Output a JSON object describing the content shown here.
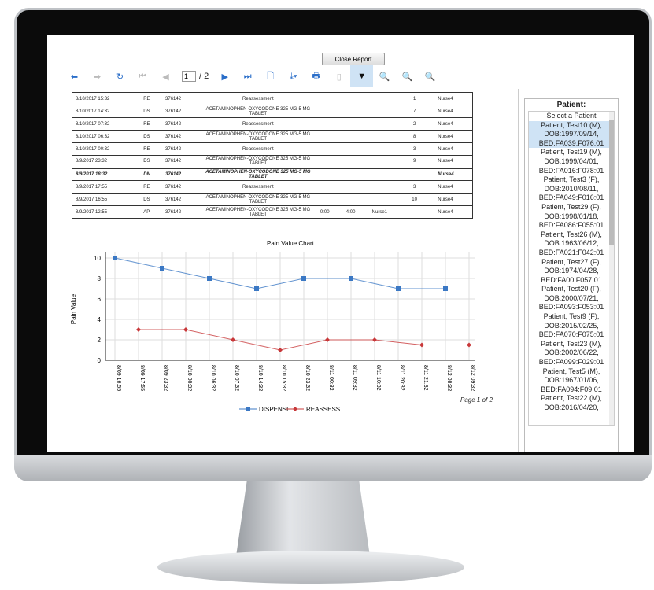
{
  "toolbar": {
    "close_label": "Close Report",
    "page_current": "1",
    "page_total": "/ 2",
    "icons": [
      "back-icon",
      "forward-icon",
      "refresh-icon",
      "first-page-icon",
      "prev-page-icon",
      "next-page-icon",
      "last-page-icon",
      "page-icon",
      "export-icon",
      "print-icon",
      "print-layout-icon",
      "filter-icon",
      "zoom-in-icon",
      "zoom-out-icon",
      "zoom-fit-icon"
    ]
  },
  "table": {
    "rows": [
      [
        "8/10/2017 15:32",
        "RE",
        "376142",
        "Reassessment",
        "",
        "",
        "",
        "1",
        "",
        "Nurse4"
      ],
      [
        "8/10/2017 14:32",
        "DS",
        "376142",
        "ACETAMINOPHEN-OXYCODONE 325 MG-5 MG TABLET",
        "",
        "",
        "",
        "7",
        "",
        "Nurse4"
      ],
      [
        "8/10/2017 07:32",
        "RE",
        "376142",
        "Reassessment",
        "",
        "",
        "",
        "2",
        "",
        "Nurse4"
      ],
      [
        "8/10/2017 06:32",
        "DS",
        "376142",
        "ACETAMINOPHEN-OXYCODONE 325 MG-5 MG TABLET",
        "",
        "",
        "",
        "8",
        "",
        "Nurse4"
      ],
      [
        "8/10/2017 00:32",
        "RE",
        "376142",
        "Reassessment",
        "",
        "",
        "",
        "3",
        "",
        "Nurse4"
      ],
      [
        "8/9/2017 23:32",
        "DS",
        "376142",
        "ACETAMINOPHEN-OXYCODONE 325 MG-5 MG TABLET",
        "",
        "",
        "",
        "9",
        "",
        "Nurse4"
      ],
      [
        "8/9/2017 18:32",
        "DN",
        "376142",
        "ACETAMINOPHEN-OXYCODONE 325 MG-5 MG TABLET",
        "",
        "",
        "",
        "",
        "",
        "Nurse4"
      ],
      [
        "8/9/2017 17:55",
        "RE",
        "376142",
        "Reassessment",
        "",
        "",
        "",
        "3",
        "",
        "Nurse4"
      ],
      [
        "8/9/2017 16:55",
        "DS",
        "376142",
        "ACETAMINOPHEN-OXYCODONE 325 MG-5 MG TABLET",
        "",
        "",
        "",
        "10",
        "",
        "Nurse4"
      ],
      [
        "8/9/2017 12:55",
        "AP",
        "376142",
        "ACETAMINOPHEN-OXYCODONE 325 MG-5 MG TABLET",
        "0:00",
        "4:00",
        "Nurse1",
        "",
        "",
        "Nurse4"
      ]
    ]
  },
  "chart_data": {
    "type": "line",
    "title": "Pain Value Chart",
    "xlabel": "",
    "ylabel": "Pain Value",
    "ylim": [
      0,
      10
    ],
    "yticks": [
      0,
      2,
      4,
      6,
      8,
      10
    ],
    "grid": true,
    "legend": "bottom",
    "categories": [
      "8/09 16:55",
      "8/09 17:55",
      "8/09 23:32",
      "8/10 00:32",
      "8/10 06:32",
      "8/10 07:32",
      "8/10 14:32",
      "8/10 15:32",
      "8/10 23:32",
      "8/11 00:32",
      "8/11 09:32",
      "8/11 10:32",
      "8/11 20:32",
      "8/11 21:32",
      "8/12 08:32",
      "8/12 09:32"
    ],
    "series": [
      {
        "name": "DISPENSE",
        "color": "#3b78c4",
        "marker": "square",
        "values": [
          10,
          null,
          9,
          null,
          8,
          null,
          7,
          null,
          8,
          null,
          8,
          null,
          7,
          null,
          7,
          null
        ]
      },
      {
        "name": "REASSESS",
        "color": "#c8383a",
        "marker": "diamond",
        "values": [
          null,
          3,
          null,
          3,
          null,
          2,
          null,
          1,
          null,
          2,
          null,
          2,
          null,
          1.5,
          null,
          1.5
        ]
      }
    ]
  },
  "footer": {
    "page_label": "Page 1 of 2"
  },
  "sidebar": {
    "title": "Patient:",
    "placeholder": "Select a Patient",
    "patients": [
      "Patient, Test10 (M), DOB:1997/09/14, BED:FA039:F076:01",
      "Patient, Test19 (M), DOB:1999/04/01, BED:FA016:F078:01",
      "Patient, Test3 (F), DOB:2010/08/11, BED:FA049:F016:01",
      "Patient, Test29 (F), DOB:1998/01/18, BED:FA086:F055:01",
      "Patient, Test26 (M), DOB:1963/06/12, BED:FA021:F042:01",
      "Patient, Test27 (F), DOB:1974/04/28, BED:FA00:F057:01",
      "Patient, Test20 (F), DOB:2000/07/21, BED:FA093:F053:01",
      "Patient, Test9 (F), DOB:2015/02/25, BED:FA070:F075:01",
      "Patient, Test23 (M), DOB:2002/06/22, BED:FA099:F029:01",
      "Patient, Test5 (M), DOB:1967/01/06, BED:FA094:F09:01",
      "Patient, Test22 (M), DOB:2016/04/20,"
    ],
    "selected_index": 0
  },
  "colors": {
    "accent": "#2a6ec9",
    "selected": "#cfe3f5"
  }
}
